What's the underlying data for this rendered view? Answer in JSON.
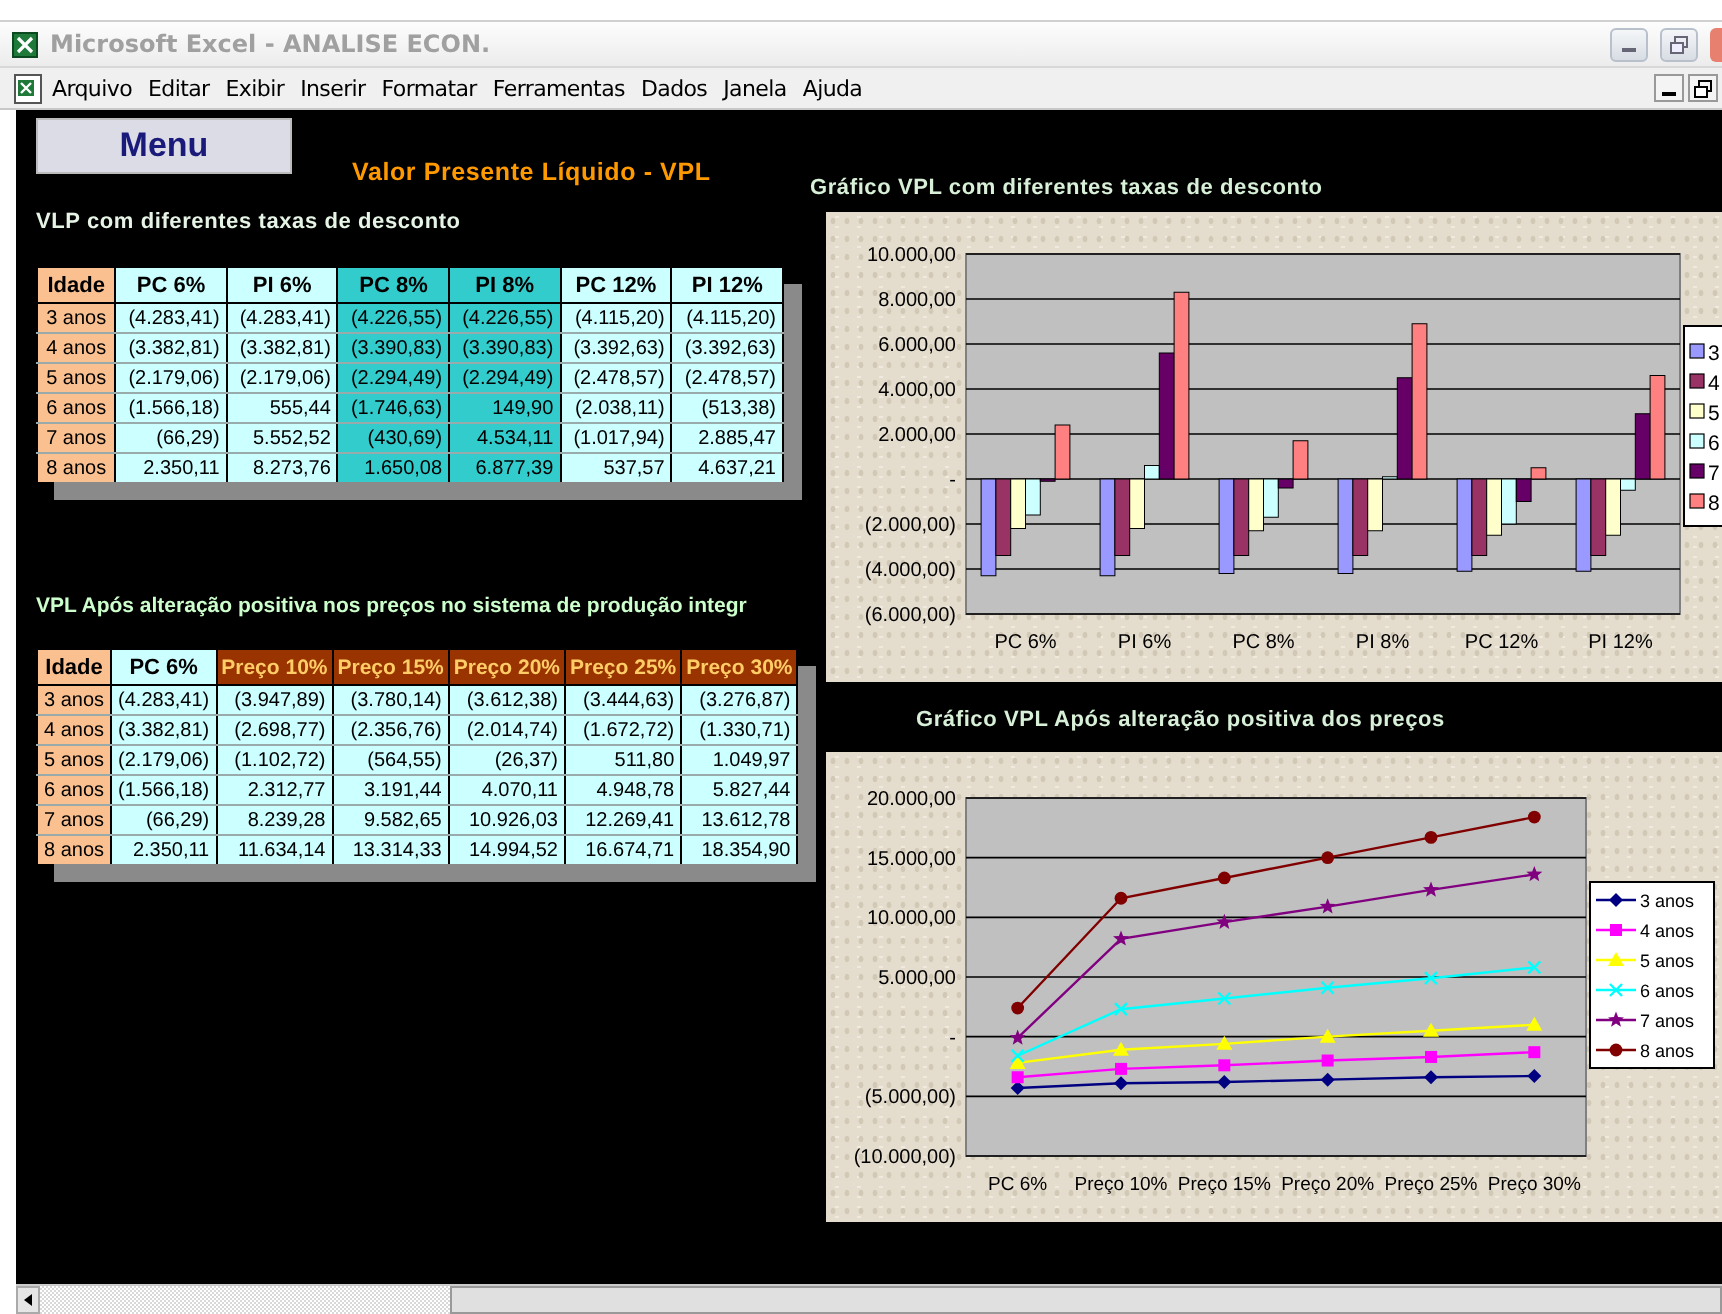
{
  "window": {
    "title": "Microsoft Excel - ANALISE ECON."
  },
  "menu_bar": [
    "Arquivo",
    "Editar",
    "Exibir",
    "Inserir",
    "Formatar",
    "Ferramentas",
    "Dados",
    "Janela",
    "Ajuda"
  ],
  "sheet": {
    "menu_button": "Menu",
    "title": "Valor Presente Líquido - VPL",
    "table_1": {
      "caption": "VLP com diferentes taxas de desconto",
      "columns": [
        {
          "header": {
            "label": "Idade",
            "color": "#fac090"
          },
          "color": "#fac090"
        },
        {
          "header": {
            "label": "PC 6%",
            "color": "#ccffff"
          },
          "color": "#ccffff"
        },
        {
          "header": {
            "label": "PI 6%",
            "color": "#ccffff"
          },
          "color": "#ccffff"
        },
        {
          "header": {
            "label": "PC 8%",
            "color": "#33cccc"
          },
          "color": "#33cccc"
        },
        {
          "header": {
            "label": "PI 8%",
            "color": "#33cccc"
          },
          "color": "#33cccc"
        },
        {
          "header": {
            "label": "PC 12%",
            "color": "#ccffff"
          },
          "color": "#ccffff"
        },
        {
          "header": {
            "label": "PI 12%",
            "color": "#ccffff"
          },
          "color": "#ccffff"
        }
      ],
      "rows": [
        [
          "3 anos",
          "(4.283,41)",
          "(4.283,41)",
          "(4.226,55)",
          "(4.226,55)",
          "(4.115,20)",
          "(4.115,20)"
        ],
        [
          "4 anos",
          "(3.382,81)",
          "(3.382,81)",
          "(3.390,83)",
          "(3.390,83)",
          "(3.392,63)",
          "(3.392,63)"
        ],
        [
          "5 anos",
          "(2.179,06)",
          "(2.179,06)",
          "(2.294,49)",
          "(2.294,49)",
          "(2.478,57)",
          "(2.478,57)"
        ],
        [
          "6 anos",
          "(1.566,18)",
          "555,44",
          "(1.746,63)",
          "149,90",
          "(2.038,11)",
          "(513,38)"
        ],
        [
          "7 anos",
          "(66,29)",
          "5.552,52",
          "(430,69)",
          "4.534,11",
          "(1.017,94)",
          "2.885,47"
        ],
        [
          "8 anos",
          "2.350,11",
          "8.273,76",
          "1.650,08",
          "6.877,39",
          "537,57",
          "4.637,21"
        ]
      ]
    },
    "table_2": {
      "caption": "VPL Após alteração positiva nos preços no sistema de produção integr",
      "columns": [
        {
          "header": {
            "label": "Idade",
            "color": "#fac090"
          },
          "color": "#fac090"
        },
        {
          "header": {
            "label": "PC 6%",
            "color": "#ccffff"
          },
          "color": "#ccffff"
        },
        {
          "header": {
            "label": "Preço 10%",
            "color": "#993300"
          },
          "color": "#ccffff"
        },
        {
          "header": {
            "label": "Preço 15%",
            "color": "#993300"
          },
          "color": "#ccffff"
        },
        {
          "header": {
            "label": "Preço 20%",
            "color": "#993300"
          },
          "color": "#ccffff"
        },
        {
          "header": {
            "label": "Preço 25%",
            "color": "#993300"
          },
          "color": "#ccffff"
        },
        {
          "header": {
            "label": "Preço 30%",
            "color": "#993300"
          },
          "color": "#ccffff"
        }
      ],
      "rows": [
        [
          "3 anos",
          "(4.283,41)",
          "(3.947,89)",
          "(3.780,14)",
          "(3.612,38)",
          "(3.444,63)",
          "(3.276,87)"
        ],
        [
          "4 anos",
          "(3.382,81)",
          "(2.698,77)",
          "(2.356,76)",
          "(2.014,74)",
          "(1.672,72)",
          "(1.330,71)"
        ],
        [
          "5 anos",
          "(2.179,06)",
          "(1.102,72)",
          "(564,55)",
          "(26,37)",
          "511,80",
          "1.049,97"
        ],
        [
          "6 anos",
          "(1.566,18)",
          "2.312,77",
          "3.191,44",
          "4.070,11",
          "4.948,78",
          "5.827,44"
        ],
        [
          "7 anos",
          "(66,29)",
          "8.239,28",
          "9.582,65",
          "10.926,03",
          "12.269,41",
          "13.612,78"
        ],
        [
          "8 anos",
          "2.350,11",
          "11.634,14",
          "13.314,33",
          "14.994,52",
          "16.674,71",
          "18.354,90"
        ]
      ]
    }
  },
  "chart_1": {
    "heading": "Gráfico  VPL com diferentes taxas de desconto",
    "chart_data": {
      "type": "bar",
      "grid": true,
      "legend": true,
      "categories": [
        "PC 6%",
        "PI 6%",
        "PC 8%",
        "PI 8%",
        "PC 12%",
        "PI 12%"
      ],
      "series": [
        {
          "name": "3",
          "color": "#9999ff",
          "values": [
            -4300,
            -4300,
            -4200,
            -4200,
            -4100,
            -4100
          ]
        },
        {
          "name": "4",
          "color": "#993366",
          "values": [
            -3400,
            -3400,
            -3400,
            -3400,
            -3400,
            -3400
          ]
        },
        {
          "name": "5",
          "color": "#ffffcc",
          "values": [
            -2200,
            -2200,
            -2300,
            -2300,
            -2500,
            -2500
          ]
        },
        {
          "name": "6",
          "color": "#ccffff",
          "values": [
            -1600,
            600,
            -1700,
            100,
            -2000,
            -500
          ]
        },
        {
          "name": "7",
          "color": "#660066",
          "values": [
            -100,
            5600,
            -400,
            4500,
            -1000,
            2900
          ]
        },
        {
          "name": "8",
          "color": "#ff8080",
          "values": [
            2400,
            8300,
            1700,
            6900,
            500,
            4600
          ]
        }
      ],
      "ylim": [
        -6000,
        10000
      ],
      "yticks": [
        {
          "value": 10000,
          "label": "10.000,00"
        },
        {
          "value": 8000,
          "label": "8.000,00"
        },
        {
          "value": 6000,
          "label": "6.000,00"
        },
        {
          "value": 4000,
          "label": "4.000,00"
        },
        {
          "value": 2000,
          "label": "2.000,00"
        },
        {
          "value": 0,
          "label": "-"
        },
        {
          "value": -2000,
          "label": "(2.000,00)"
        },
        {
          "value": -4000,
          "label": "(4.000,00)"
        },
        {
          "value": -6000,
          "label": "(6.000,00)"
        }
      ]
    }
  },
  "chart_2": {
    "heading": "Gráfico  VPL Após alteração positiva dos preços",
    "chart_data": {
      "type": "line",
      "grid": true,
      "legend": true,
      "categories": [
        "PC 6%",
        "Preço 10%",
        "Preço 15%",
        "Preço 20%",
        "Preço 25%",
        "Preço 30%"
      ],
      "series": [
        {
          "name": "3 anos",
          "color": "#000080",
          "marker": "diamond",
          "values": [
            -4300,
            -3900,
            -3800,
            -3600,
            -3400,
            -3300
          ]
        },
        {
          "name": "4 anos",
          "color": "#ff00ff",
          "marker": "square",
          "values": [
            -3400,
            -2700,
            -2400,
            -2000,
            -1700,
            -1300
          ]
        },
        {
          "name": "5 anos",
          "color": "#ffff00",
          "marker": "triangle",
          "values": [
            -2200,
            -1100,
            -600,
            0,
            500,
            1000
          ]
        },
        {
          "name": "6 anos",
          "color": "#00ffff",
          "marker": "cross",
          "values": [
            -1600,
            2300,
            3200,
            4100,
            4900,
            5800
          ]
        },
        {
          "name": "7 anos",
          "color": "#800080",
          "marker": "star",
          "values": [
            -100,
            8200,
            9600,
            10900,
            12300,
            13600
          ]
        },
        {
          "name": "8 anos",
          "color": "#800000",
          "marker": "circle",
          "values": [
            2400,
            11600,
            13300,
            15000,
            16700,
            18400
          ]
        }
      ],
      "ylim": [
        -10000,
        20000
      ],
      "yticks": [
        {
          "value": 20000,
          "label": "20.000,00"
        },
        {
          "value": 15000,
          "label": "15.000,00"
        },
        {
          "value": 10000,
          "label": "10.000,00"
        },
        {
          "value": 5000,
          "label": "5.000,00"
        },
        {
          "value": 0,
          "label": "-"
        },
        {
          "value": -5000,
          "label": "(5.000,00)"
        },
        {
          "value": -10000,
          "label": "(10.000,00)"
        }
      ]
    }
  }
}
